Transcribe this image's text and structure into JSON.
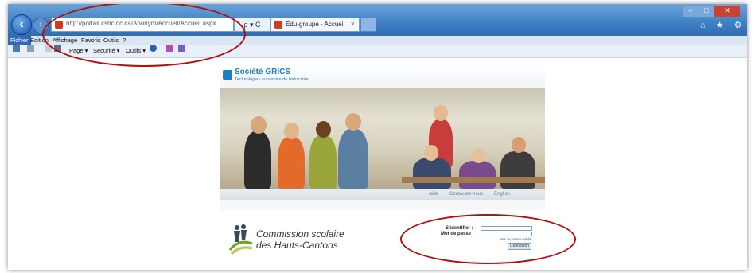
{
  "browser": {
    "address": {
      "url": "http://portail.cshc.qc.ca/Anonym/Accueil/Accueil.aspx"
    },
    "address_tools": "ρ ▾ C",
    "tab": {
      "label": "Édu-groupe - Accueil",
      "close": "×"
    },
    "window_buttons": {
      "minimize": "–",
      "maximize": "□",
      "close": "✕"
    },
    "toolbar_icons": "⌂ ★ ⚙",
    "menu": [
      "Fichier",
      "Edition",
      "Affichage",
      "Favoris",
      "Outils",
      "?"
    ],
    "command_bar": {
      "page": "Page ▾",
      "security": "Sécurité ▾",
      "tools": "Outils ▾"
    }
  },
  "site": {
    "brand": "Société GRICS",
    "tagline": "Technologies au service de l'éducation",
    "nav": [
      "Aide",
      "Contactez-nous",
      "English"
    ],
    "organization_line1": "Commission scolaire",
    "organization_line2": "des Hauts-Cantons",
    "login": {
      "username_label": "S'identifier :",
      "password_label": "Mot de passe :",
      "forgot_link": "Mot de passe oublié",
      "submit_label": "Connexion"
    }
  },
  "colors": {
    "title_bar": "#3f7fc4",
    "accent_brand": "#1c7cc4",
    "annotation": "#b01010"
  }
}
